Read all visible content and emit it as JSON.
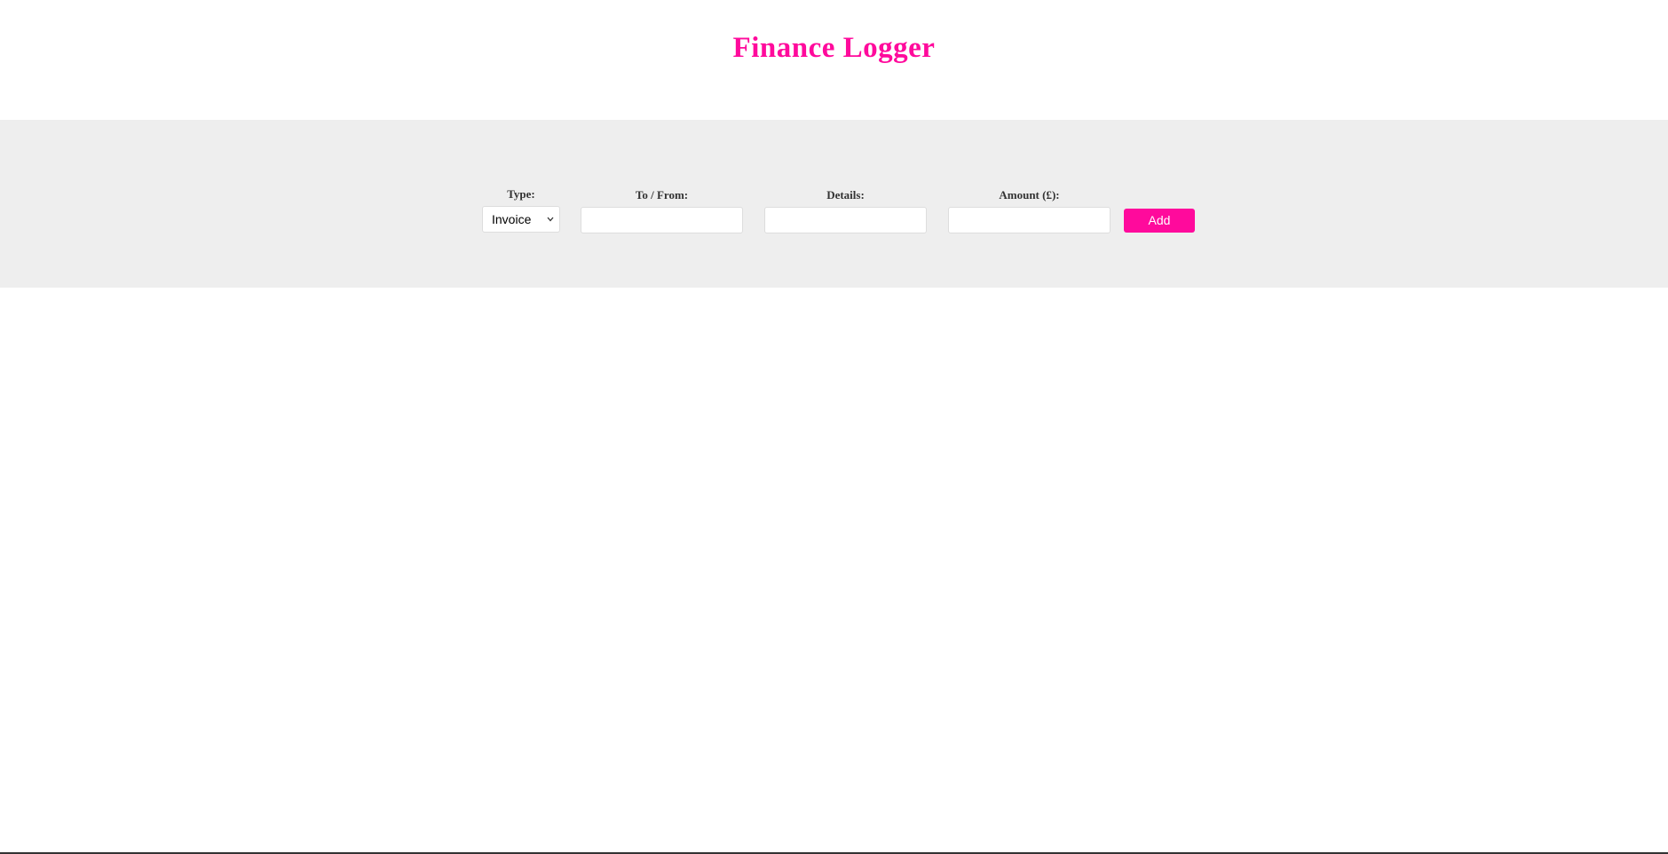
{
  "header": {
    "title": "Finance Logger"
  },
  "form": {
    "type": {
      "label": "Type:",
      "selected": "Invoice"
    },
    "to_from": {
      "label": "To / From:",
      "value": ""
    },
    "details": {
      "label": "Details:",
      "value": ""
    },
    "amount": {
      "label": "Amount (£):",
      "value": ""
    },
    "add_label": "Add"
  },
  "icons": {
    "dropdown": "chevron-down-icon"
  },
  "colors": {
    "accent": "#ff0a9c",
    "band": "#eeeeee",
    "label": "#333333"
  }
}
